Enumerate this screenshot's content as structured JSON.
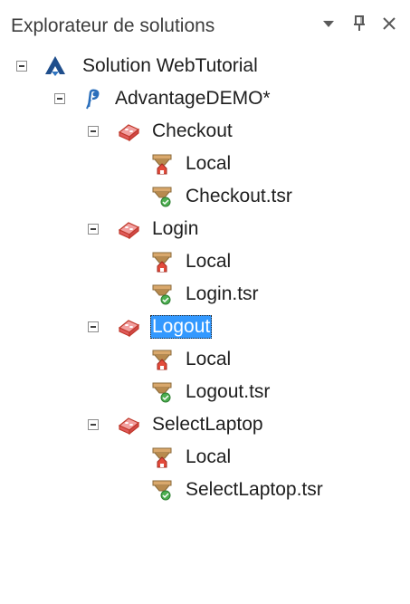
{
  "panel": {
    "title": "Explorateur de solutions",
    "icons": [
      "dropdown-arrow-icon",
      "pin-icon",
      "close-icon"
    ]
  },
  "tree": {
    "solution": "Solution WebTutorial",
    "project": "AdvantageDEMO*",
    "scripts": [
      {
        "name": "Checkout",
        "local": "Local",
        "file": "Checkout.tsr",
        "selected": false
      },
      {
        "name": "Login",
        "local": "Local",
        "file": "Login.tsr",
        "selected": false
      },
      {
        "name": "Logout",
        "local": "Local",
        "file": "Logout.tsr",
        "selected": true
      },
      {
        "name": "SelectLaptop",
        "local": "Local",
        "file": "SelectLaptop.tsr",
        "selected": false
      }
    ]
  },
  "colors": {
    "selection": "#3399ff",
    "solution_icon": "#1f4e8c",
    "project_icon": "#2a6ebb",
    "script_icon": "#e05a5a"
  }
}
